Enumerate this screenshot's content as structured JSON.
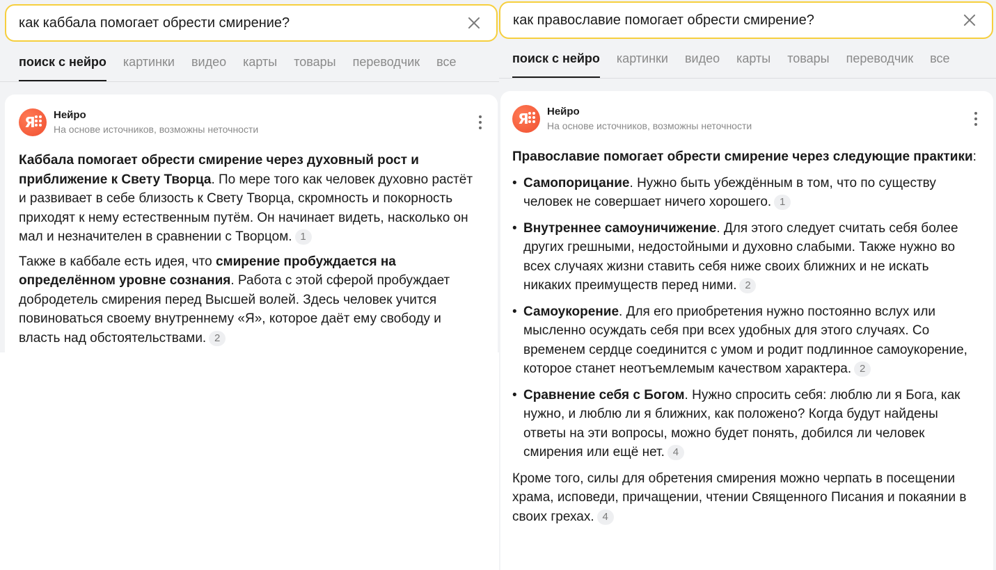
{
  "left": {
    "search": {
      "value": "как каббала помогает обрести смирение?"
    },
    "tabs": [
      "поиск с нейро",
      "картинки",
      "видео",
      "карты",
      "товары",
      "переводчик",
      "все"
    ],
    "card": {
      "title": "Нейро",
      "subtitle": "На основе источников, возможны неточности",
      "p1_bold": "Каббала помогает обрести смирение через духовный рост и приближение к Свету Творца",
      "p1_text": ". По мере того как человек духовно растёт и развивает в себе близость к Свету Творца, скромность и покорность приходят к нему естественным путём. Он начинает видеть, насколько он мал и незначителен в сравнении с Творцом.",
      "p1_ref": "1",
      "p2_pre": "Также в каббале есть идея, что ",
      "p2_bold": "смирение пробуждается на определённом уровне сознания",
      "p2_text": ". Работа с этой сферой пробуждает добродетель смирения перед Высшей волей. Здесь человек учится повиноваться своему внутреннему «Я», которое даёт ему свободу и власть над обстоятельствами.",
      "p2_ref": "2"
    }
  },
  "right": {
    "search": {
      "value": "как православие помогает обрести смирение?"
    },
    "tabs": [
      "поиск с нейро",
      "картинки",
      "видео",
      "карты",
      "товары",
      "переводчик",
      "все"
    ],
    "card": {
      "title": "Нейро",
      "subtitle": "На основе источников, возможны неточности",
      "intro_bold": "Православие помогает обрести смирение через следующие практики",
      "intro_text": ":",
      "items": [
        {
          "bold": "Самопорицание",
          "text": ". Нужно быть убеждённым в том, что по существу человек не совершает ничего хорошего.",
          "ref": "1"
        },
        {
          "bold": "Внутреннее самоуничижение",
          "text": ". Для этого следует считать себя более других грешными, недостойными и духовно слабыми. Также нужно во всех случаях жизни ставить себя ниже своих ближних и не искать никаких преимуществ перед ними.",
          "ref": "2"
        },
        {
          "bold": "Самоукорение",
          "text": ". Для его приобретения нужно постоянно вслух или мысленно осуждать себя при всех удобных для этого случаях. Со временем сердце соединится с умом и родит подлинное самоукорение, которое станет неотъемлемым качеством характера.",
          "ref": "2"
        },
        {
          "bold": "Сравнение себя с Богом",
          "text": ". Нужно спросить себя: люблю ли я Бога, как нужно, и люблю ли я ближних, как положено? Когда будут найдены ответы на эти вопросы, можно будет понять, добился ли человек смирения или ещё нет.",
          "ref": "4"
        }
      ],
      "closing": "Кроме того, силы для обретения смирения можно черпать в посещении храма, исповеди, причащении, чтении Священного Писания и покаянии в своих грехах.",
      "closing_ref": "4"
    }
  }
}
